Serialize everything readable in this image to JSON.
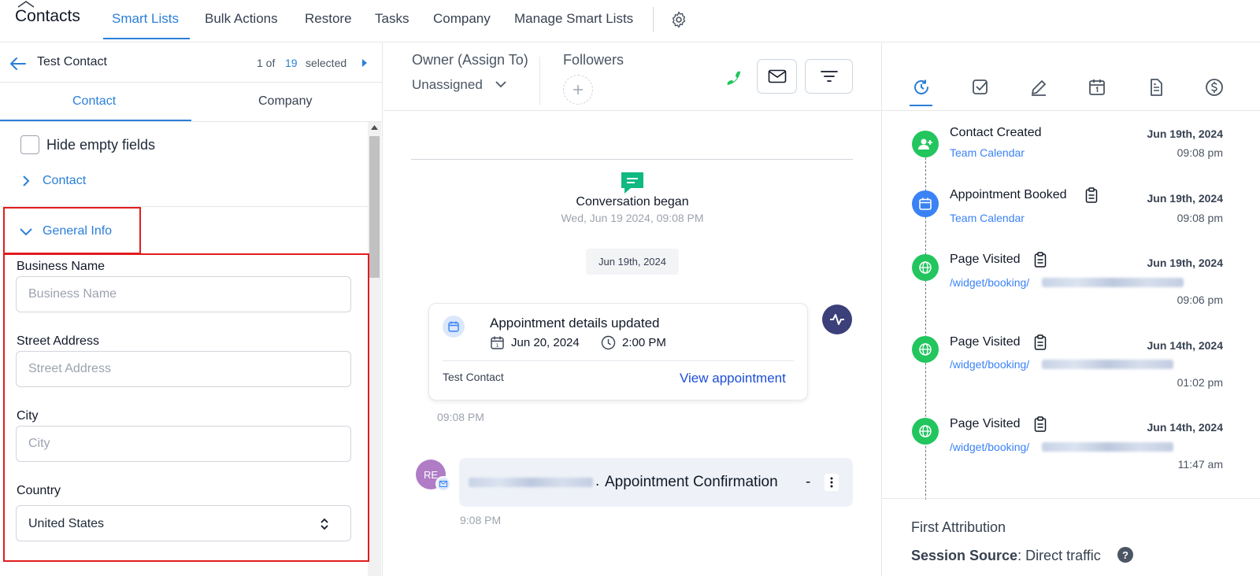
{
  "nav": {
    "title": "Contacts",
    "items": [
      "Smart Lists",
      "Bulk Actions",
      "Restore",
      "Tasks",
      "Company",
      "Manage Smart Lists"
    ]
  },
  "left": {
    "contact_name": "Test Contact",
    "pager_prefix": "1 of",
    "pager_total": "19",
    "pager_suffix": "selected",
    "tabs": [
      "Contact",
      "Company"
    ],
    "hide_empty_label": "Hide empty fields",
    "section_contact": "Contact",
    "section_general": "General Info",
    "fields": {
      "business_label": "Business Name",
      "business_placeholder": "Business Name",
      "street_label": "Street Address",
      "street_placeholder": "Street Address",
      "city_label": "City",
      "city_placeholder": "City",
      "country_label": "Country",
      "country_value": "United States"
    }
  },
  "center": {
    "owner_label": "Owner (Assign To)",
    "owner_value": "Unassigned",
    "followers_label": "Followers",
    "conversation_began": "Conversation began",
    "conversation_time": "Wed, Jun 19 2024, 09:08 PM",
    "date_pill": "Jun 19th, 2024",
    "appointment": {
      "title": "Appointment details updated",
      "date": "Jun 20, 2024",
      "time": "2:00 PM",
      "contact": "Test Contact",
      "link": "View appointment",
      "timestamp": "09:08 PM"
    },
    "email": {
      "avatar": "RE",
      "subject": "Appointment Confirmation",
      "separator": "-",
      "timestamp": "9:08 PM"
    },
    "colors": {
      "phone": "#22c55e",
      "chat": "#10b981",
      "activity": "#3b3f7a"
    }
  },
  "right": {
    "tab_icons": [
      "activity-clock-icon",
      "task-check-icon",
      "note-pen-icon",
      "calendar-icon",
      "document-icon",
      "dollar-icon"
    ],
    "timeline": [
      {
        "title": "Contact Created",
        "sub": "Team Calendar",
        "date": "Jun 19th, 2024",
        "time": "09:08 pm",
        "icon": "user-plus-icon",
        "color": "#22c55e"
      },
      {
        "title": "Appointment Booked",
        "sub": "Team Calendar",
        "date": "Jun 19th, 2024",
        "time": "09:08 pm",
        "icon": "calendar-icon",
        "color": "#3b82f6"
      },
      {
        "title": "Page Visited",
        "sub": "/widget/booking/",
        "date": "Jun 19th, 2024",
        "time": "09:06 pm",
        "icon": "globe-icon",
        "color": "#22c55e"
      },
      {
        "title": "Page Visited",
        "sub": "/widget/booking/",
        "date": "Jun 14th, 2024",
        "time": "01:02 pm",
        "icon": "globe-icon",
        "color": "#22c55e"
      },
      {
        "title": "Page Visited",
        "sub": "/widget/booking/",
        "date": "Jun 14th, 2024",
        "time": "11:47 am",
        "icon": "globe-icon",
        "color": "#22c55e"
      }
    ],
    "first_attribution": "First Attribution",
    "session_source_label": "Session Source",
    "session_source_value": ": Direct traffic"
  }
}
